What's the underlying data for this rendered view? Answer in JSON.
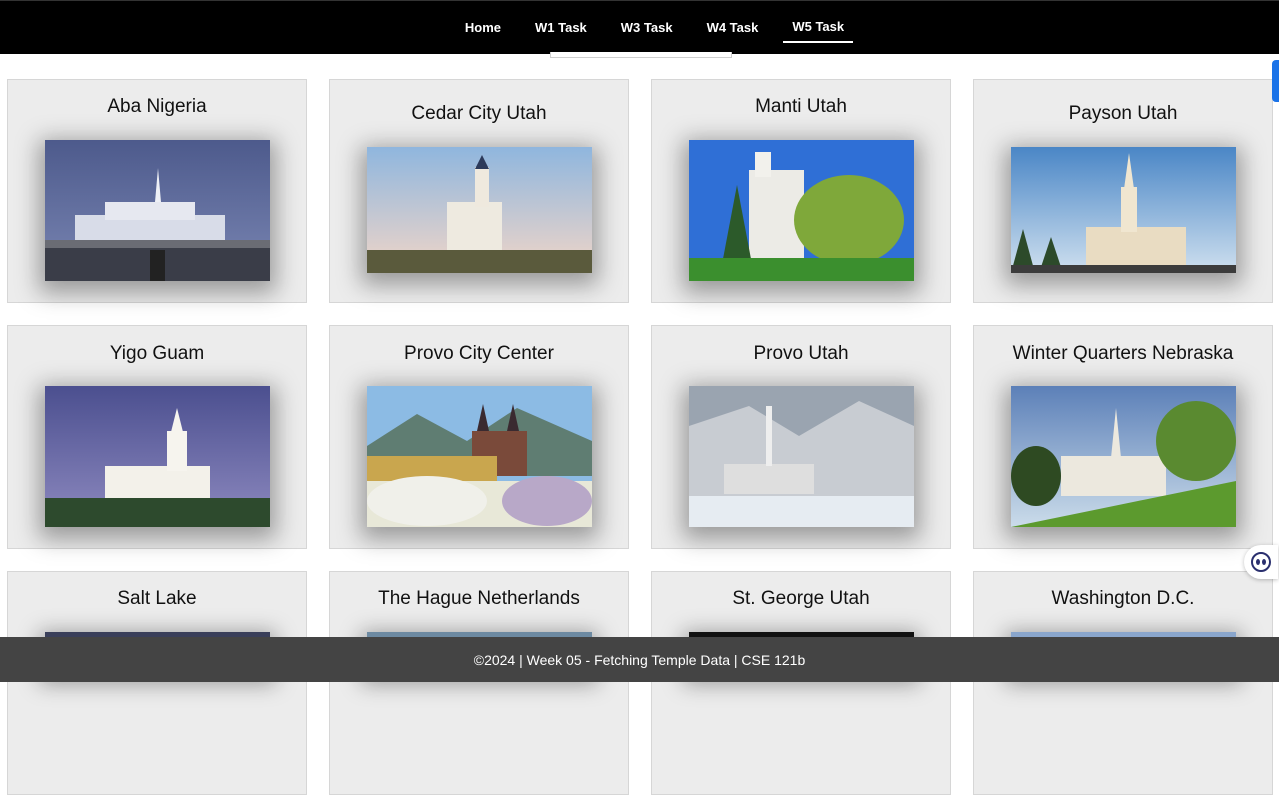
{
  "nav": {
    "items": [
      {
        "label": "Home",
        "active": false
      },
      {
        "label": "W1 Task",
        "active": false
      },
      {
        "label": "W3 Task",
        "active": false
      },
      {
        "label": "W4 Task",
        "active": false
      },
      {
        "label": "W5 Task",
        "active": true
      }
    ]
  },
  "temples": [
    {
      "name": "Aba Nigeria"
    },
    {
      "name": "Cedar City Utah"
    },
    {
      "name": "Manti Utah"
    },
    {
      "name": "Payson Utah"
    },
    {
      "name": "Yigo Guam"
    },
    {
      "name": "Provo City Center"
    },
    {
      "name": "Provo Utah"
    },
    {
      "name": "Winter Quarters Nebraska"
    },
    {
      "name": "Salt Lake"
    },
    {
      "name": "The Hague Netherlands"
    },
    {
      "name": "St. George Utah"
    },
    {
      "name": "Washington D.C."
    }
  ],
  "footer": {
    "text": "©2024 | Week 05 - Fetching Temple Data | CSE 121b"
  },
  "colors": {
    "header_bg": "#000000",
    "footer_bg": "#444444",
    "card_bg": "#ececec",
    "scroll_accent": "#1a73e8"
  }
}
